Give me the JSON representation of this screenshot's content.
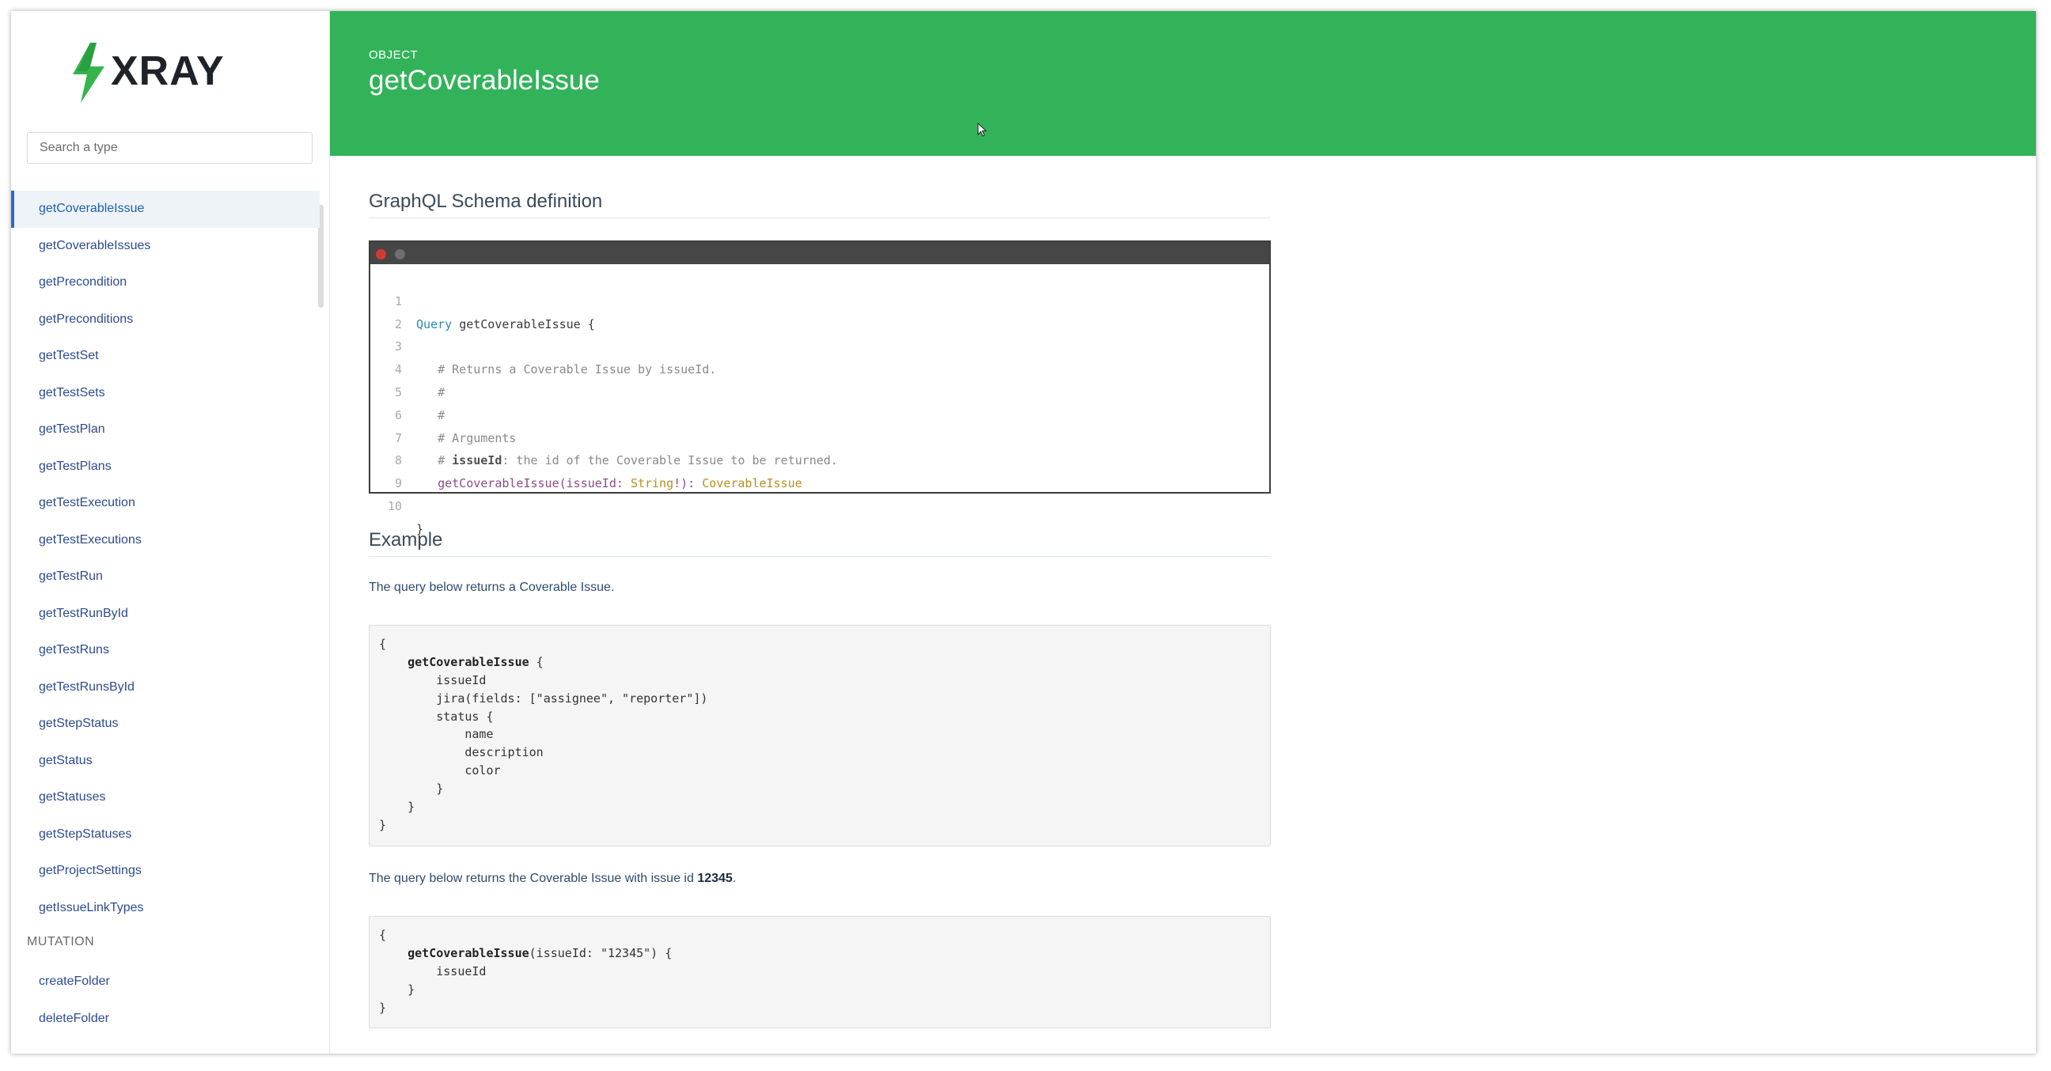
{
  "sidebar": {
    "logo_text": "XRAY",
    "search_placeholder": "Search a type",
    "query_items": [
      {
        "label": "getCoverableIssue",
        "active": true
      },
      {
        "label": "getCoverableIssues"
      },
      {
        "label": "getPrecondition"
      },
      {
        "label": "getPreconditions"
      },
      {
        "label": "getTestSet"
      },
      {
        "label": "getTestSets"
      },
      {
        "label": "getTestPlan"
      },
      {
        "label": "getTestPlans"
      },
      {
        "label": "getTestExecution"
      },
      {
        "label": "getTestExecutions"
      },
      {
        "label": "getTestRun"
      },
      {
        "label": "getTestRunById"
      },
      {
        "label": "getTestRuns"
      },
      {
        "label": "getTestRunsById"
      },
      {
        "label": "getStepStatus"
      },
      {
        "label": "getStatus"
      },
      {
        "label": "getStatuses"
      },
      {
        "label": "getStepStatuses"
      },
      {
        "label": "getProjectSettings"
      },
      {
        "label": "getIssueLinkTypes"
      }
    ],
    "mutation_heading": "MUTATION",
    "mutation_items": [
      {
        "label": "createFolder"
      },
      {
        "label": "deleteFolder"
      }
    ]
  },
  "header": {
    "kind": "OBJECT",
    "title": "getCoverableIssue",
    "background_color": "#32b35a"
  },
  "schema": {
    "heading": "GraphQL Schema definition",
    "line_numbers": [
      "1",
      "2",
      "3",
      "4",
      "5",
      "6",
      "7",
      "8",
      "9",
      "10"
    ],
    "line1_keyword": "Query",
    "line1_name": "getCoverableIssue {",
    "line3": "# Returns a Coverable Issue by issueId.",
    "line4": "#",
    "line5": "#",
    "line6": "# Arguments",
    "line7_hash": "# ",
    "line7_arg": "issueId",
    "line7_rest": ": the id of the Coverable Issue to be returned.",
    "line8_fn": "getCoverableIssue(",
    "line8_arg": "issueId: ",
    "line8_type": "String",
    "line8_bang": "!): ",
    "line8_ret": "CoverableIssue",
    "line10": "}"
  },
  "example": {
    "heading": "Example",
    "desc1": "The query below returns a Coverable Issue.",
    "code1": [
      "{",
      "    getCoverableIssue {",
      "        issueId",
      "        jira(fields: [\"assignee\", \"reporter\"])",
      "        status {",
      "            name",
      "            description",
      "            color",
      "        }",
      "    }",
      "}"
    ],
    "desc2_prefix": "The query below returns the Coverable Issue with issue id ",
    "desc2_bold": "12345",
    "desc2_suffix": ".",
    "code2": [
      "{",
      "    getCoverableIssue(issueId: \"12345\") {",
      "        issueId",
      "    }",
      "}"
    ]
  }
}
